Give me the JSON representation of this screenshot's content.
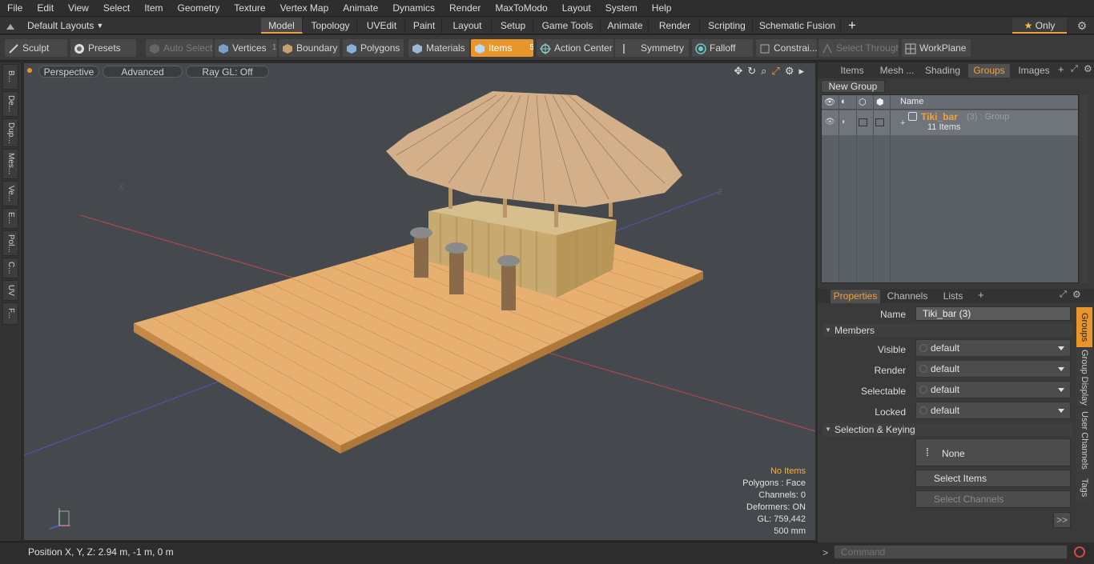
{
  "menu": [
    "File",
    "Edit",
    "View",
    "Select",
    "Item",
    "Geometry",
    "Texture",
    "Vertex Map",
    "Animate",
    "Dynamics",
    "Render",
    "MaxToModo",
    "Layout",
    "System",
    "Help"
  ],
  "layouts_label": "Default Layouts",
  "mode_tabs": [
    "Model",
    "Topology",
    "UVEdit",
    "Paint",
    "Layout",
    "Setup",
    "Game Tools",
    "Animate",
    "Render",
    "Scripting",
    "Schematic Fusion"
  ],
  "only_label": "Only",
  "toolbar": {
    "sculpt": "Sculpt",
    "presets": "Presets",
    "auto_select": "Auto Select",
    "vertices": "Vertices",
    "vertices_count": "1",
    "boundary": "Boundary",
    "polygons": "Polygons",
    "materials": "Materials",
    "items": "Items",
    "items_count": "5",
    "action_center": "Action Center",
    "symmetry": "Symmetry",
    "falloff": "Falloff",
    "constraints": "Constrai...",
    "select_through": "Select Through",
    "workplane": "WorkPlane"
  },
  "left_tabs": [
    "B...",
    "De...",
    "Dup...",
    "Mes...",
    "Ve...",
    "E...",
    "Pol...",
    "C...",
    "UV",
    "F..."
  ],
  "viewport": {
    "view_label": "Perspective",
    "shading_label": "Advanced",
    "raygl_label": "Ray GL: Off",
    "info": {
      "items": "No Items",
      "polygons": "Polygons : Face",
      "channels": "Channels: 0",
      "deformers": "Deformers: ON",
      "gl": "GL: 759,442",
      "grid": "500 mm"
    },
    "axis_labels": {
      "x": "X",
      "y": "Y",
      "z": "Z"
    }
  },
  "status": {
    "position": "Position X, Y, Z:  2.94 m, -1 m, 0 m"
  },
  "panel_top": {
    "tabs": [
      "Items",
      "Mesh ...",
      "Shading",
      "Groups",
      "Images"
    ],
    "new_group": "New Group",
    "col_name": "Name",
    "group_name": "Tiki_bar",
    "group_suffix": "(3) : Group",
    "group_items": "11 Items"
  },
  "panel_bottom": {
    "tabs": [
      "Properties",
      "Channels",
      "Lists"
    ],
    "name_label": "Name",
    "name_value": "Tiki_bar (3)",
    "members_label": "Members",
    "rows": [
      {
        "label": "Visible",
        "value": "default"
      },
      {
        "label": "Render",
        "value": "default"
      },
      {
        "label": "Selectable",
        "value": "default"
      },
      {
        "label": "Locked",
        "value": "default"
      }
    ],
    "selection_label": "Selection & Keying",
    "none_label": "None",
    "select_items": "Select Items",
    "select_channels": "Select Channels",
    "more": ">>",
    "side_tabs": [
      "Groups",
      "Group Display",
      "User Channels",
      "Tags"
    ]
  },
  "command_placeholder": "Command",
  "accent_color": "#e8962c"
}
